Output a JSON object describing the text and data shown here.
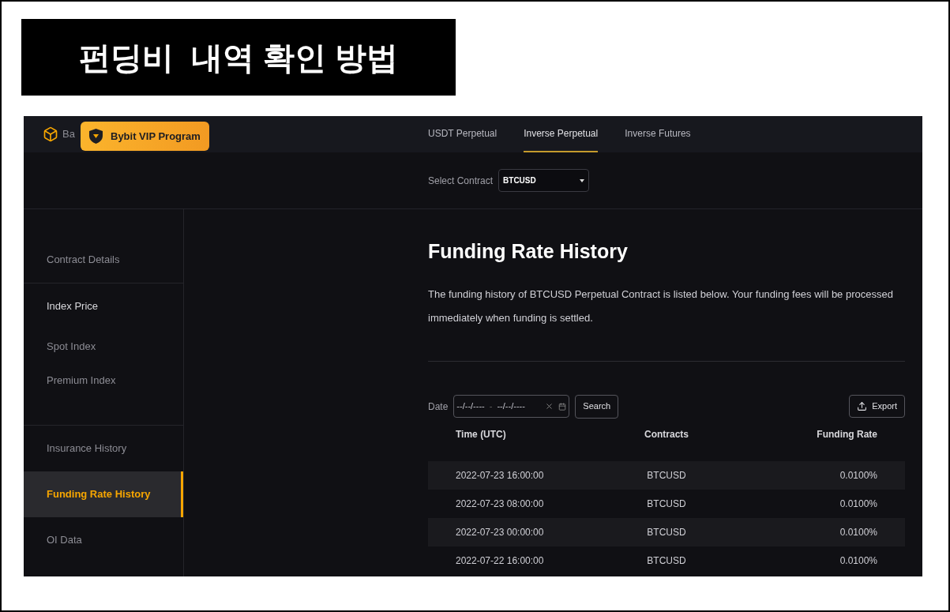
{
  "banner": {
    "title": "펀딩비  내역 확인 방법"
  },
  "header": {
    "brand": "Ba",
    "tooltip": "Bybit VIP Program",
    "tabs": [
      {
        "label": "USDT Perpetual",
        "selected": false
      },
      {
        "label": "Inverse Perpetual",
        "selected": true
      },
      {
        "label": "Inverse Futures",
        "selected": false
      }
    ]
  },
  "contract_select": {
    "label": "Select Contract",
    "value": "BTCUSD"
  },
  "sidebar": {
    "sections": [
      [
        {
          "label": "Contract Details",
          "kind": "link",
          "selected": false
        }
      ],
      [
        {
          "label": "Index Price",
          "kind": "group",
          "selected": false
        },
        {
          "label": "Spot Index",
          "kind": "sub",
          "selected": false
        },
        {
          "label": "Premium Index",
          "kind": "sub",
          "selected": false
        }
      ],
      [
        {
          "label": "Insurance History",
          "kind": "link",
          "selected": false
        },
        {
          "label": "Funding Rate History",
          "kind": "link",
          "selected": true
        },
        {
          "label": "OI Data",
          "kind": "link",
          "selected": false
        }
      ]
    ]
  },
  "main": {
    "title": "Funding Rate History",
    "description": "The funding history of BTCUSD Perpetual Contract is listed below. Your funding fees will be processed immediately when funding is settled.",
    "date_label": "Date",
    "date_from": "--/--/----",
    "date_separator": "-",
    "date_to": "--/--/----",
    "search_button": "Search",
    "export_button": "Export",
    "table": {
      "columns": [
        "Time (UTC)",
        "Contracts",
        "Funding Rate"
      ],
      "rows": [
        [
          "2022-07-23 16:00:00",
          "BTCUSD",
          "0.0100%"
        ],
        [
          "2022-07-23 08:00:00",
          "BTCUSD",
          "0.0100%"
        ],
        [
          "2022-07-23 00:00:00",
          "BTCUSD",
          "0.0100%"
        ],
        [
          "2022-07-22 16:00:00",
          "BTCUSD",
          "0.0100%"
        ]
      ]
    }
  }
}
